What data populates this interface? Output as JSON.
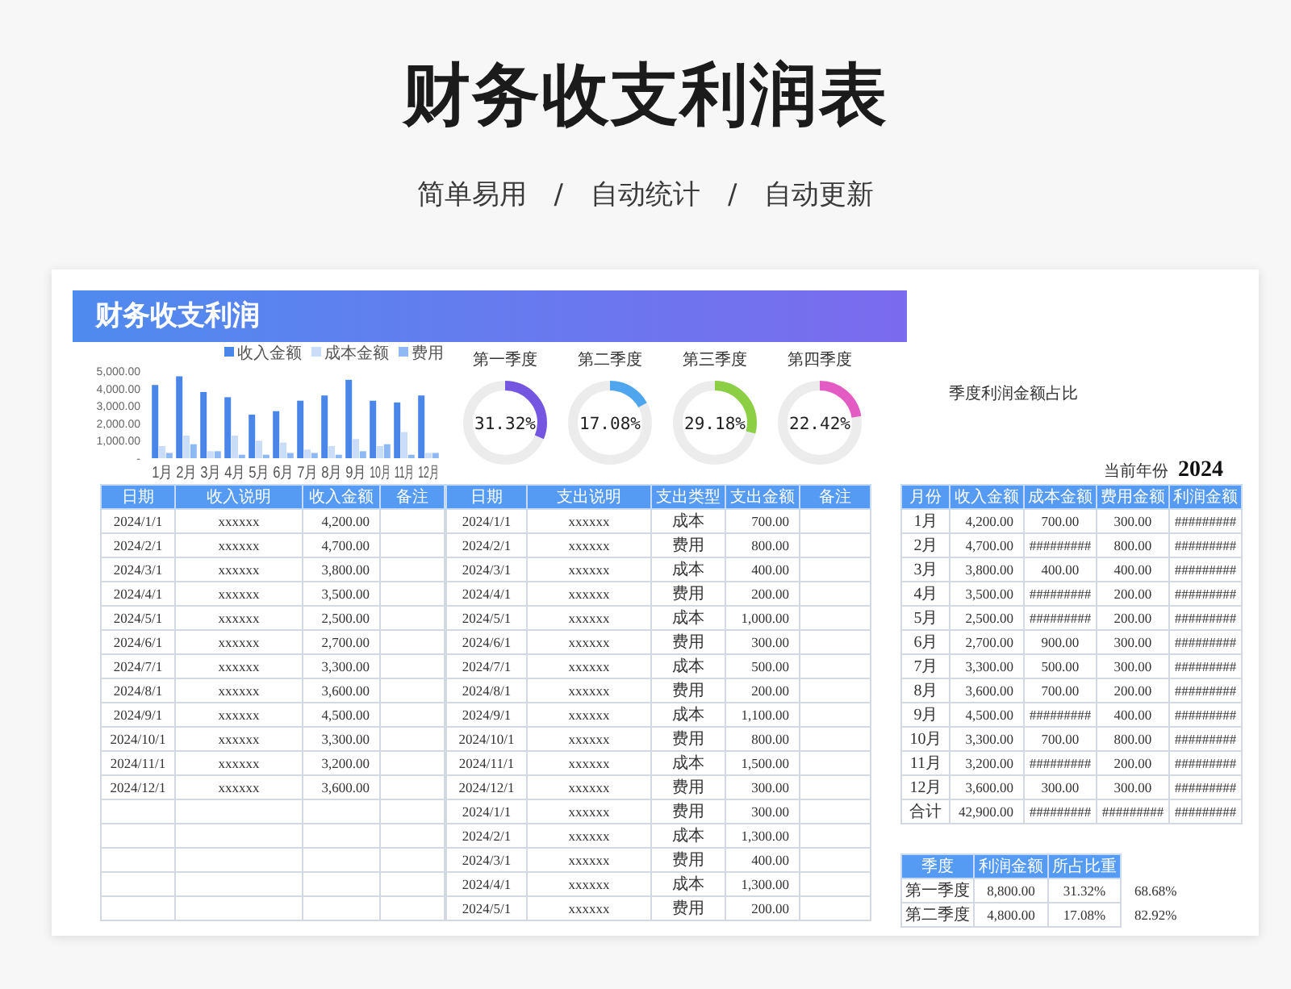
{
  "page_title": "财务收支利润表",
  "subtitle": "简单易用　/　自动统计　/　自动更新",
  "sheet": {
    "banner": "财务收支利润",
    "chart_data": {
      "type": "bar",
      "stacked": false,
      "legend": true,
      "categories": [
        "1月",
        "2月",
        "3月",
        "4月",
        "5月",
        "6月",
        "7月",
        "8月",
        "9月",
        "10月",
        "11月",
        "12月"
      ],
      "series": [
        {
          "name": "收入金额",
          "color": "#4a86e8",
          "values": [
            4200,
            4700,
            3800,
            3500,
            2500,
            2700,
            3300,
            3600,
            4500,
            3300,
            3200,
            3600
          ]
        },
        {
          "name": "成本金额",
          "color": "#c9ddf8",
          "values": [
            700,
            1300,
            400,
            1300,
            1000,
            900,
            500,
            700,
            1100,
            700,
            1500,
            300
          ]
        },
        {
          "name": "费用",
          "color": "#8fb9f2",
          "values": [
            300,
            800,
            400,
            200,
            200,
            300,
            300,
            200,
            400,
            800,
            200,
            300
          ]
        }
      ],
      "ylim": [
        0,
        5000
      ],
      "yticks": [
        {
          "value": 0,
          "label": "-"
        },
        {
          "value": 1000,
          "label": "1,000.00"
        },
        {
          "value": 2000,
          "label": "2,000.00"
        },
        {
          "value": 3000,
          "label": "3,000.00"
        },
        {
          "value": 4000,
          "label": "4,000.00"
        },
        {
          "value": 5000,
          "label": "5,000.00"
        }
      ]
    },
    "quarters": [
      {
        "title": "第一季度",
        "percent": "31.32%",
        "level": 0.3132,
        "color": "#7556e0"
      },
      {
        "title": "第二季度",
        "percent": "17.08%",
        "level": 0.1708,
        "color": "#4fa6ee"
      },
      {
        "title": "第三季度",
        "percent": "29.18%",
        "level": 0.2918,
        "color": "#8ccf45"
      },
      {
        "title": "第四季度",
        "percent": "22.42%",
        "level": 0.2242,
        "color": "#e25cc4"
      }
    ],
    "quarter_chart_caption": "季度利润金额占比",
    "year_label": "当前年份",
    "year": "2024",
    "income_table": {
      "columns": [
        "日期",
        "收入说明",
        "收入金额",
        "备注"
      ],
      "rows": [
        [
          "2024/1/1",
          "xxxxxx",
          "4,200.00"
        ],
        [
          "2024/2/1",
          "xxxxxx",
          "4,700.00"
        ],
        [
          "2024/3/1",
          "xxxxxx",
          "3,800.00"
        ],
        [
          "2024/4/1",
          "xxxxxx",
          "3,500.00"
        ],
        [
          "2024/5/1",
          "xxxxxx",
          "2,500.00"
        ],
        [
          "2024/6/1",
          "xxxxxx",
          "2,700.00"
        ],
        [
          "2024/7/1",
          "xxxxxx",
          "3,300.00"
        ],
        [
          "2024/8/1",
          "xxxxxx",
          "3,600.00"
        ],
        [
          "2024/9/1",
          "xxxxxx",
          "4,500.00"
        ],
        [
          "2024/10/1",
          "xxxxxx",
          "3,300.00"
        ],
        [
          "2024/11/1",
          "xxxxxx",
          "3,200.00"
        ],
        [
          "2024/12/1",
          "xxxxxx",
          "3,600.00"
        ]
      ]
    },
    "expense_table": {
      "columns": [
        "日期",
        "支出说明",
        "支出类型",
        "支出金额",
        "备注"
      ],
      "rows": [
        [
          "2024/1/1",
          "xxxxxx",
          "成本",
          "700.00"
        ],
        [
          "2024/2/1",
          "xxxxxx",
          "费用",
          "800.00"
        ],
        [
          "2024/3/1",
          "xxxxxx",
          "成本",
          "400.00"
        ],
        [
          "2024/4/1",
          "xxxxxx",
          "费用",
          "200.00"
        ],
        [
          "2024/5/1",
          "xxxxxx",
          "成本",
          "1,000.00"
        ],
        [
          "2024/6/1",
          "xxxxxx",
          "费用",
          "300.00"
        ],
        [
          "2024/7/1",
          "xxxxxx",
          "成本",
          "500.00"
        ],
        [
          "2024/8/1",
          "xxxxxx",
          "费用",
          "200.00"
        ],
        [
          "2024/9/1",
          "xxxxxx",
          "成本",
          "1,100.00"
        ],
        [
          "2024/10/1",
          "xxxxxx",
          "费用",
          "800.00"
        ],
        [
          "2024/11/1",
          "xxxxxx",
          "成本",
          "1,500.00"
        ],
        [
          "2024/12/1",
          "xxxxxx",
          "费用",
          "300.00"
        ],
        [
          "2024/1/1",
          "xxxxxx",
          "费用",
          "300.00"
        ],
        [
          "2024/2/1",
          "xxxxxx",
          "成本",
          "1,300.00"
        ],
        [
          "2024/3/1",
          "xxxxxx",
          "费用",
          "400.00"
        ],
        [
          "2024/4/1",
          "xxxxxx",
          "成本",
          "1,300.00"
        ],
        [
          "2024/5/1",
          "xxxxxx",
          "费用",
          "200.00"
        ]
      ]
    },
    "monthly_table": {
      "columns": [
        "月份",
        "收入金额",
        "成本金额",
        "费用金额",
        "利润金额"
      ],
      "rows": [
        [
          "1月",
          "4,200.00",
          "700.00",
          "300.00",
          "#########"
        ],
        [
          "2月",
          "4,700.00",
          "#########",
          "800.00",
          "#########"
        ],
        [
          "3月",
          "3,800.00",
          "400.00",
          "400.00",
          "#########"
        ],
        [
          "4月",
          "3,500.00",
          "#########",
          "200.00",
          "#########"
        ],
        [
          "5月",
          "2,500.00",
          "#########",
          "200.00",
          "#########"
        ],
        [
          "6月",
          "2,700.00",
          "900.00",
          "300.00",
          "#########"
        ],
        [
          "7月",
          "3,300.00",
          "500.00",
          "300.00",
          "#########"
        ],
        [
          "8月",
          "3,600.00",
          "700.00",
          "200.00",
          "#########"
        ],
        [
          "9月",
          "4,500.00",
          "#########",
          "400.00",
          "#########"
        ],
        [
          "10月",
          "3,300.00",
          "700.00",
          "800.00",
          "#########"
        ],
        [
          "11月",
          "3,200.00",
          "#########",
          "200.00",
          "#########"
        ],
        [
          "12月",
          "3,600.00",
          "300.00",
          "300.00",
          "#########"
        ],
        [
          "合计",
          "42,900.00",
          "#########",
          "#########",
          "#########"
        ]
      ]
    },
    "quarter_table": {
      "columns": [
        "季度",
        "利润金额",
        "所占比重"
      ],
      "rows": [
        [
          "第一季度",
          "8,800.00",
          "31.32%",
          "68.68%"
        ],
        [
          "第二季度",
          "4,800.00",
          "17.08%",
          "82.92%"
        ]
      ]
    }
  }
}
